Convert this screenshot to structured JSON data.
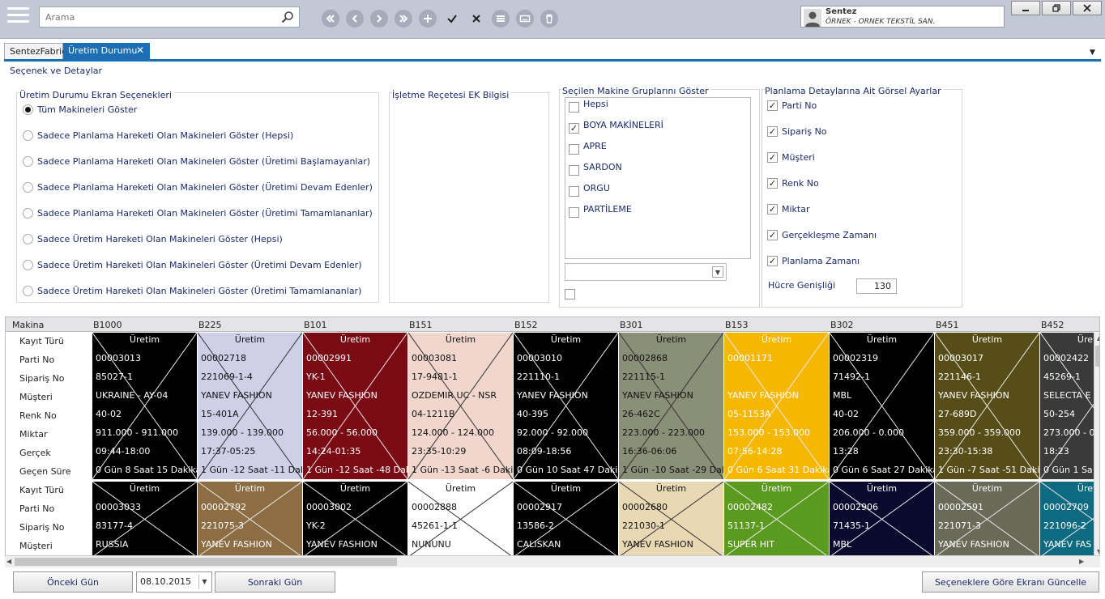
{
  "search": {
    "placeholder": "Arama"
  },
  "user": {
    "name": "Sentez",
    "company": "ÖRNEK - ORNEK TEKSTİL SAN."
  },
  "tabs": [
    {
      "label": "SentezFabric"
    },
    {
      "label": "Üretim Durumu"
    }
  ],
  "section_title": "Seçenek ve Detaylar",
  "screen_options": {
    "title": "Üretim Durumu Ekran Seçenekleri",
    "options": [
      {
        "label": "Tüm Makineleri Göster",
        "selected": true
      },
      {
        "label": "Sadece Planlama Hareketi Olan Makineleri Göster (Hepsi)",
        "selected": false
      },
      {
        "label": "Sadece Planlama Hareketi Olan Makineleri Göster (Üretimi Başlamayanlar)",
        "selected": false
      },
      {
        "label": "Sadece Planlama Hareketi Olan Makineleri Göster (Üretimi Devam Edenler)",
        "selected": false
      },
      {
        "label": "Sadece Planlama Hareketi Olan Makineleri Göster (Üretimi Tamamlananlar)",
        "selected": false
      },
      {
        "label": "Sadece Üretim Hareketi Olan Makineleri Göster (Hepsi)",
        "selected": false
      },
      {
        "label": "Sadece Üretim Hareketi Olan Makineleri Göster (Üretimi Devam Edenler)",
        "selected": false
      },
      {
        "label": "Sadece Üretim Hareketi Olan Makineleri Göster (Üretimi Tamamlananlar)",
        "selected": false
      }
    ]
  },
  "recipe_info": {
    "title": "İşletme Reçetesi EK Bilgisi"
  },
  "machine_groups": {
    "title": "Seçilen Makine Gruplarını Göster",
    "items": [
      {
        "label": "Hepsi",
        "checked": false
      },
      {
        "label": "BOYA MAKİNELERİ",
        "checked": true
      },
      {
        "label": "APRE",
        "checked": false
      },
      {
        "label": "SARDON",
        "checked": false
      },
      {
        "label": "ORGU",
        "checked": false
      },
      {
        "label": "PARTİLEME",
        "checked": false
      }
    ],
    "dropdown_value": "",
    "extra_checked": false
  },
  "visual_settings": {
    "title": "Planlama Detaylarına Ait Görsel Ayarlar",
    "items": [
      {
        "label": "Parti No",
        "checked": true
      },
      {
        "label": "Sipariş No",
        "checked": true
      },
      {
        "label": "Müşteri",
        "checked": true
      },
      {
        "label": "Renk No",
        "checked": true
      },
      {
        "label": "Miktar",
        "checked": true
      },
      {
        "label": "Gerçekleşme Zamanı",
        "checked": true
      },
      {
        "label": "Planlama Zamanı",
        "checked": true
      }
    ],
    "cell_width_label": "Hücre Genişliği",
    "cell_width_value": "130"
  },
  "grid": {
    "machine_label": "Makina",
    "row_labels": [
      "Kayıt Türü",
      "Parti No",
      "Sipariş No",
      "Müşteri",
      "Renk No",
      "Miktar",
      "Gerçek",
      "Geçen Süre"
    ],
    "columns": [
      "B1000",
      "B225",
      "B101",
      "B151",
      "B152",
      "B301",
      "B153",
      "B302",
      "B451",
      "B452"
    ],
    "rows": [
      [
        {
          "type": "Üretim",
          "values": [
            "00003013",
            "85027-1",
            "UKRAINE - AY-04",
            "40-02",
            "911.000 - 911.000",
            "09:44-18:00",
            "0 Gün 8 Saat 15 Dakika"
          ],
          "bg": "#000000",
          "fg": "#ffffff"
        },
        {
          "type": "Üretim",
          "values": [
            "00002718",
            "221069-1-4",
            "YANEV FASHION",
            "15-401A",
            "139.000 - 139.000",
            "17:37-05:25",
            "1 Gün -12 Saat -11 Dakika"
          ],
          "bg": "#cfcfe8",
          "fg": "#111111"
        },
        {
          "type": "Üretim",
          "values": [
            "00002991",
            "YK-1",
            "YANEV FASHION",
            "12-391",
            "56.000 - 56.000",
            "14:24-01:35",
            "1 Gün -12 Saat -48 Dakika"
          ],
          "bg": "#7a0a14",
          "fg": "#ffffff"
        },
        {
          "type": "Üretim",
          "values": [
            "00003081",
            "17-9481-1",
            "OZDEMIR UC - NSR",
            "04-1211B",
            "124.000 - 124.000",
            "23:35-10:29",
            "1 Gün -13 Saat -6 Dakika"
          ],
          "bg": "#f0d6cd",
          "fg": "#111111"
        },
        {
          "type": "Üretim",
          "values": [
            "00003010",
            "221110-1",
            "YANEV FASHION",
            "40-395",
            "92.000 - 92.000",
            "08:09-18:56",
            "0 Gün 10 Saat 47 Dakika"
          ],
          "bg": "#000000",
          "fg": "#ffffff"
        },
        {
          "type": "Üretim",
          "values": [
            "00002868",
            "221115-1",
            "YANEV FASHION",
            "26-462C",
            "223.000 - 223.000",
            "16:36-06:06",
            "1 Gün -10 Saat -29 Dakika"
          ],
          "bg": "#8a8f78",
          "fg": "#111111"
        },
        {
          "type": "Üretim",
          "values": [
            "00001171",
            "",
            "YANEV FASHION",
            "05-1153A",
            "153.000 - 153.000",
            "07:56-14:28",
            "0 Gün 6 Saat 31 Dakika"
          ],
          "bg": "#f5b700",
          "fg": "#ffffff"
        },
        {
          "type": "Üretim",
          "values": [
            "00002319",
            "71492-1",
            "MBL",
            "40-02",
            "206.000 - 0.000",
            "13:28",
            "0 Gün 6 Saat 27 Dakika"
          ],
          "bg": "#000000",
          "fg": "#ffffff"
        },
        {
          "type": "Üretim",
          "values": [
            "00003017",
            "221146-1",
            "YANEV FASHION",
            "27-689D",
            "359.000 - 359.000",
            "23:30-15:38",
            "1 Gün -7 Saat -51 Dakika"
          ],
          "bg": "#574d18",
          "fg": "#ffffff"
        },
        {
          "type": "Üretim",
          "values": [
            "00002422",
            "45269-1",
            "SELECTA E",
            "50-254",
            "273.000 - 0",
            "18:23",
            "0 Gün 1 Sa"
          ],
          "bg": "#3a3a3a",
          "fg": "#ffffff"
        }
      ],
      [
        {
          "type": "Üretim",
          "values": [
            "00003033",
            "83177-4",
            "RUSSIA"
          ],
          "bg": "#000000",
          "fg": "#ffffff"
        },
        {
          "type": "Üretim",
          "values": [
            "00002792",
            "221075-3",
            "YANEV FASHION"
          ],
          "bg": "#8c6d44",
          "fg": "#ffffff"
        },
        {
          "type": "Üretim",
          "values": [
            "00003002",
            "YK-2",
            "YANEV FASHION"
          ],
          "bg": "#000000",
          "fg": "#ffffff"
        },
        {
          "type": "Üretim",
          "values": [
            "00002888",
            "45261-1-1",
            "NUNUNU"
          ],
          "bg": "#ffffff",
          "fg": "#111111"
        },
        {
          "type": "Üretim",
          "values": [
            "00002917",
            "13586-2",
            "CALISKAN"
          ],
          "bg": "#000000",
          "fg": "#ffffff"
        },
        {
          "type": "Üretim",
          "values": [
            "00002680",
            "221030-1",
            "YANEV FASHION"
          ],
          "bg": "#e9d8b4",
          "fg": "#111111"
        },
        {
          "type": "Üretim",
          "values": [
            "00002482",
            "51137-1",
            "SUPER HIT"
          ],
          "bg": "#5a9a1e",
          "fg": "#ffffff"
        },
        {
          "type": "Üretim",
          "values": [
            "00002906",
            "71435-1",
            "MBL"
          ],
          "bg": "#0a0a2e",
          "fg": "#ffffff"
        },
        {
          "type": "Üretim",
          "values": [
            "00002591",
            "221071-3",
            "YANEV FASHION"
          ],
          "bg": "#6a6a58",
          "fg": "#ffffff"
        },
        {
          "type": "Üretim",
          "values": [
            "00002709",
            "221096-2",
            "YANEV FAS"
          ],
          "bg": "#0e6a80",
          "fg": "#ffffff"
        }
      ]
    ]
  },
  "footer": {
    "prev_label": "Önceki Gün",
    "date_value": "08.10.2015",
    "next_label": "Sonraki Gün",
    "refresh_label": "Seçeneklere Göre Ekranı Güncelle"
  }
}
